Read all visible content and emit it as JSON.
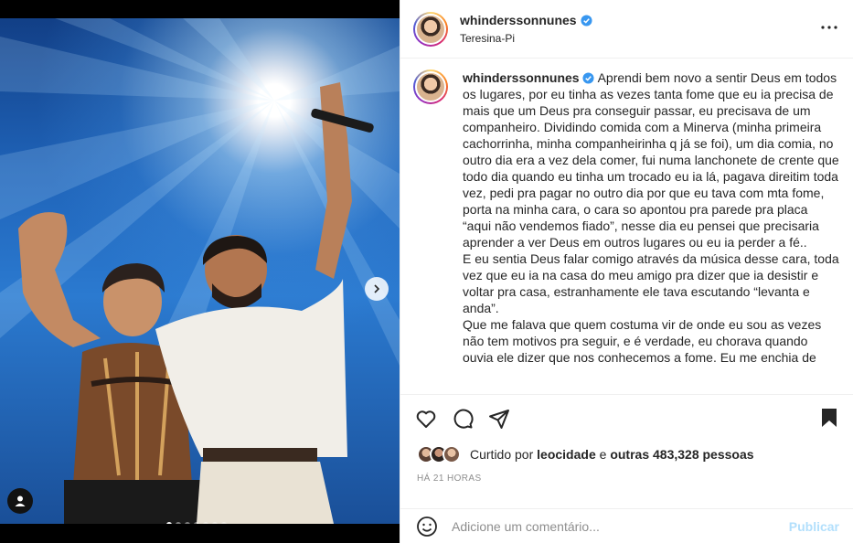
{
  "post": {
    "username": "whinderssonnunes",
    "location": "Teresina-Pi",
    "verified": true,
    "caption_paragraphs": [
      "Aprendi bem novo a sentir Deus em todos os lugares, por eu tinha as vezes tanta fome que eu ia precisa de mais que um Deus pra conseguir passar, eu precisava de um companheiro. Dividindo comida com a Minerva (minha primeira cachorrinha, minha companheirinha q já se foi), um dia comia, no outro dia era a vez dela comer, fui numa lanchonete de crente que todo dia quando eu tinha um trocado eu ia lá, pagava direitim toda vez, pedi pra pagar no outro dia por que eu tava com mta fome, porta na minha cara, o cara so apontou pra parede pra placa “aqui não vendemos fiado”, nesse dia eu pensei que precisaria aprender a ver Deus em outros lugares ou eu ia perder a fé..",
      "E eu sentia Deus falar comigo através da música desse cara, toda vez que eu ia na casa do meu amigo pra dizer que ia desistir e voltar pra casa, estranhamente ele tava escutando “levanta e anda”.",
      "Que me falava que quem costuma vir de onde eu sou as vezes não tem motivos pra seguir, e é verdade, eu chorava quando ouvia ele dizer que nos conhecemos a fome. Eu me enchia de"
    ],
    "likes_prefix": "Curtido por",
    "likes_user": "leocidade",
    "likes_connector": "e",
    "likes_others": "outras 483,328 pessoas",
    "timestamp": "HÁ 21 HORAS",
    "carousel_count": 7,
    "carousel_active": 0
  },
  "comment": {
    "placeholder": "Adicione um comentário...",
    "post_label": "Publicar"
  },
  "icons": {
    "more": "more-horizontal-icon",
    "like": "heart-icon",
    "comment": "comment-bubble-icon",
    "share": "paper-plane-icon",
    "save": "bookmark-icon",
    "emoji": "emoji-smile-icon",
    "next": "chevron-right-icon",
    "tag": "user-tag-icon",
    "verified": "verified-badge-icon"
  },
  "colors": {
    "verified": "#3897f0",
    "post_button_disabled": "#b2dffc",
    "secondary_text": "#8e8e8e"
  }
}
